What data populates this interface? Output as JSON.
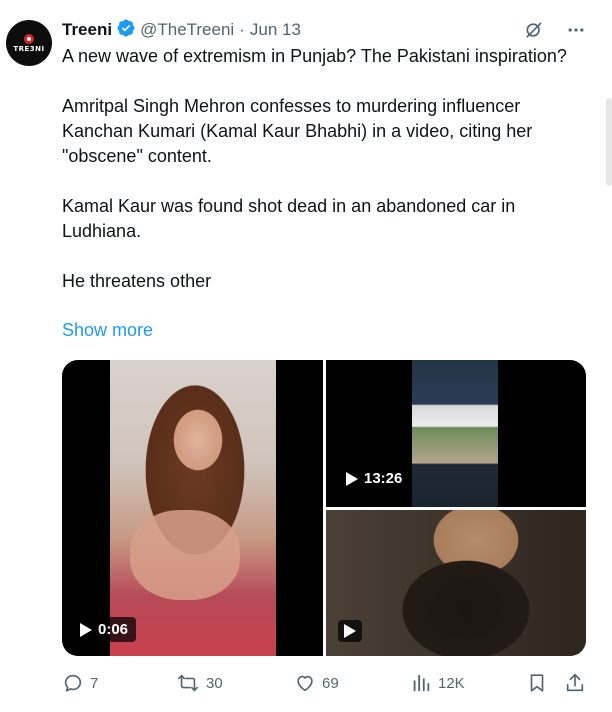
{
  "author": {
    "name": "Treeni",
    "handle": "@TheTreeni",
    "date": "Jun 13",
    "avatar_text": "TRE3NI"
  },
  "body": {
    "paragraphs": [
      "A new wave of extremism in Punjab? The Pakistani inspiration?",
      "Amritpal Singh Mehron confesses to murdering influencer Kanchan Kumari (Kamal Kaur Bhabhi) in a video, citing her \"obscene\" content.",
      "Kamal Kaur was found shot dead in an abandoned car in Ludhiana.",
      "He threatens other"
    ],
    "show_more": "Show more"
  },
  "media": {
    "videos": [
      {
        "duration": "0:06"
      },
      {
        "duration": "13:26"
      },
      {
        "duration": ""
      }
    ]
  },
  "actions": {
    "replies": "7",
    "reposts": "30",
    "likes": "69",
    "views": "12K"
  },
  "icons": {
    "verified": "verified-badge-icon",
    "grok": "grok-icon",
    "more": "more-icon",
    "reply": "reply-icon",
    "repost": "repost-icon",
    "like": "like-icon",
    "views": "views-icon",
    "bookmark": "bookmark-icon",
    "share": "share-icon",
    "play": "play-icon"
  },
  "colors": {
    "accent": "#1d9bf0",
    "secondary_text": "#536471",
    "primary_text": "#0f1419"
  }
}
